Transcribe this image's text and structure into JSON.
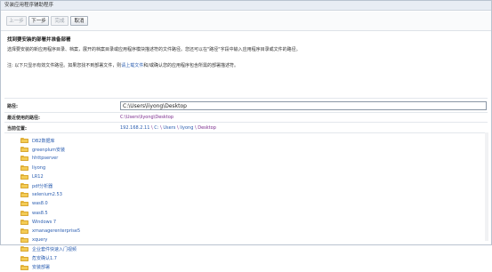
{
  "window": {
    "title": "安装应用程序辅助程序"
  },
  "toolbar": {
    "prev_label": "上一步",
    "next_label": "下一步",
    "finish_label": "完成",
    "cancel_label": "取消"
  },
  "content": {
    "heading": "找到要安装的部署并准备部署",
    "description": "选择要安装的新应用程序目录、档案，展开的档案目录或应用程序模块描述符的文件路径。您还可以在\"路径\"字段中输入应用程序目录或文件的路径。",
    "note_prefix": "注: 以下只显示有效文件路径。如果您找不到部署文件，则",
    "note_link": "请上载文件",
    "note_suffix": "和/或确认您的应用程序包含所需的部署描述符。"
  },
  "path": {
    "label": "路径:",
    "value": "C:\\Users\\liyong\\Desktop"
  },
  "recent": {
    "label": "最近使用的路径:",
    "value": "C:\\Users\\liyong\\Desktop"
  },
  "current": {
    "label": "当前位置:",
    "server": "192.168.2.11",
    "segments": [
      "C:",
      "Users",
      "liyong",
      "Desktop"
    ]
  },
  "tree": {
    "items": [
      "DB2数据库",
      "greenplum安装",
      "hhttpserver",
      "liyong",
      "LR12",
      "pdf分析器",
      "selenium2.53",
      "was8.0",
      "was8.5",
      "Windows 7",
      "xmanagerenterprise5",
      "xquery",
      "企业套件快速入门视频",
      "危安确认1.7",
      "安装部署"
    ]
  },
  "colors": {
    "link": "#2a5db0",
    "visited": "#7a2a8c",
    "folder": "#f4cc55"
  }
}
